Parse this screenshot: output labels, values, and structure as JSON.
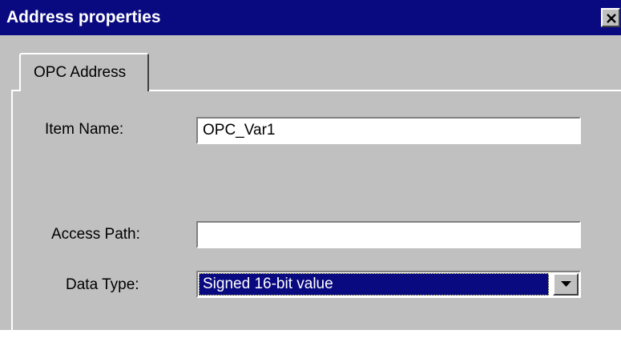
{
  "window": {
    "title": "Address properties"
  },
  "tabs": [
    {
      "label": "OPC Address",
      "selected": true
    }
  ],
  "form": {
    "item_name": {
      "label": "Item Name:",
      "value": "OPC_Var1"
    },
    "access_path": {
      "label": "Access Path:",
      "value": ""
    },
    "data_type": {
      "label": "Data Type:",
      "selected": "Signed 16-bit value"
    }
  },
  "icons": {
    "close": "close-icon",
    "dropdown": "chevron-down-icon"
  },
  "colors": {
    "titlebar": "#0a0a80",
    "face": "#c0c0c0",
    "selection": "#0a0a80"
  }
}
